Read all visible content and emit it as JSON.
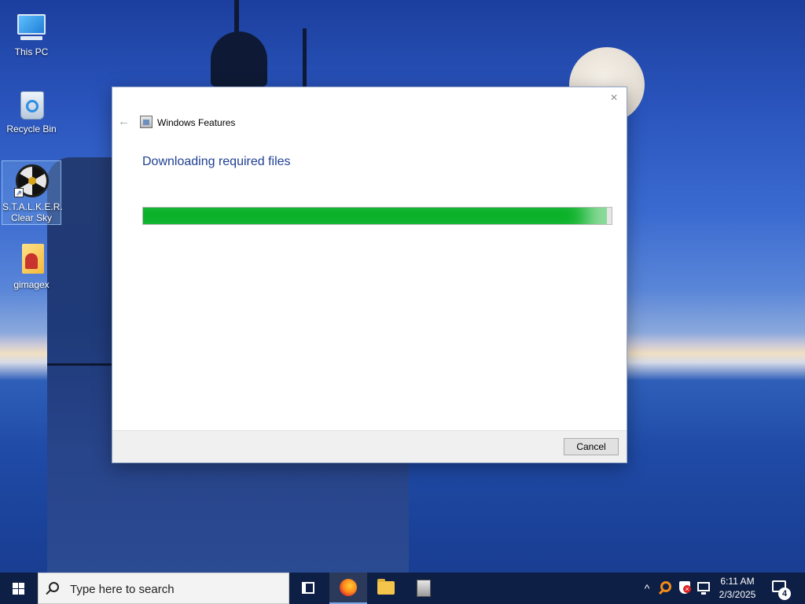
{
  "desktop": {
    "icons": [
      {
        "label": "This PC",
        "icon": "computer-icon"
      },
      {
        "label": "Recycle Bin",
        "icon": "recycle-bin-icon"
      },
      {
        "label": "S.T.A.L.K.E.R. Clear Sky",
        "icon": "stalker-game-icon"
      },
      {
        "label": "gimagex",
        "icon": "gimagex-icon"
      }
    ]
  },
  "dialog": {
    "title": "Windows Features",
    "heading": "Downloading required files",
    "progress_fraction": 0.99,
    "cancel_label": "Cancel",
    "close_glyph": "×",
    "back_glyph": "←"
  },
  "taskbar": {
    "search_placeholder": "Type here to search",
    "time": "6:11 AM",
    "date": "2/3/2025",
    "notification_count": "4",
    "apps": [
      "task-view-icon",
      "firefox-icon",
      "file-explorer-icon",
      "windows-features-icon"
    ]
  },
  "colors": {
    "accent_heading": "#1f3f92",
    "progress": "#06b025",
    "taskbar": "#0e1f45"
  }
}
